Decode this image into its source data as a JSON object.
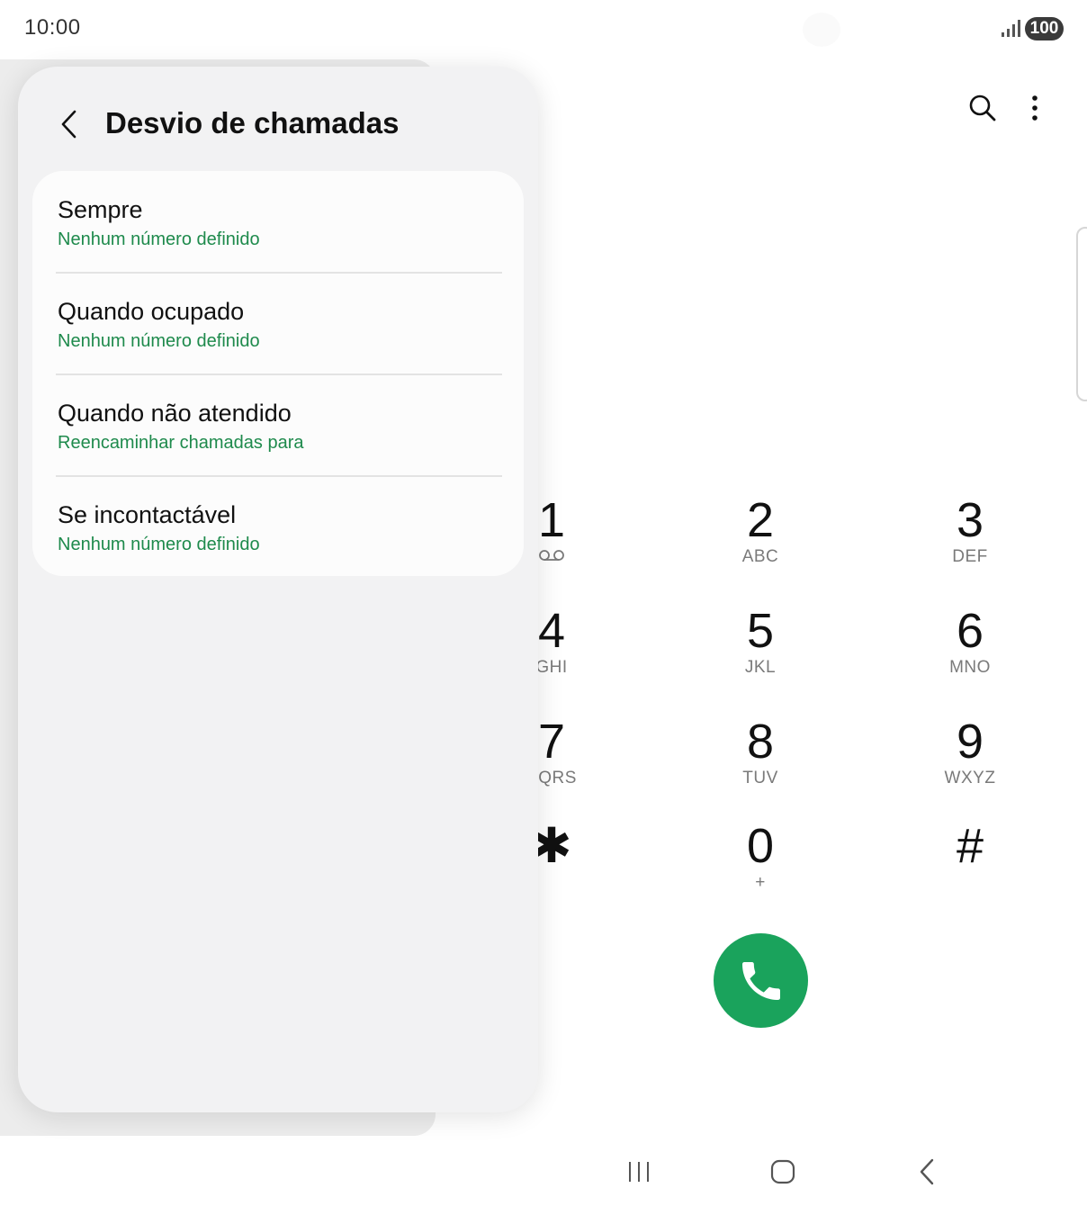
{
  "status_bar": {
    "time": "10:00",
    "battery": "100",
    "icons": [
      "signal-icon",
      "battery-icon"
    ]
  },
  "dialer": {
    "keys": [
      {
        "digit": "1",
        "letters": ""
      },
      {
        "digit": "2",
        "letters": "ABC"
      },
      {
        "digit": "3",
        "letters": "DEF"
      },
      {
        "digit": "4",
        "letters": "GHI"
      },
      {
        "digit": "5",
        "letters": "JKL"
      },
      {
        "digit": "6",
        "letters": "MNO"
      },
      {
        "digit": "7",
        "letters": "PQRS"
      },
      {
        "digit": "8",
        "letters": "TUV"
      },
      {
        "digit": "9",
        "letters": "WXYZ"
      },
      {
        "digit": "✱",
        "letters": ""
      },
      {
        "digit": "0",
        "letters": "+"
      },
      {
        "digit": "#",
        "letters": ""
      }
    ],
    "call_color": "#1aa35c",
    "icons": [
      "search-icon",
      "more-options-icon",
      "voicemail-icon",
      "phone-icon"
    ]
  },
  "panel": {
    "title": "Desvio de chamadas",
    "accent": "#1e8a4c",
    "options": [
      {
        "label": "Sempre",
        "sub": "Nenhum número definido"
      },
      {
        "label": "Quando ocupado",
        "sub": "Nenhum número definido"
      },
      {
        "label": "Quando não atendido",
        "sub": "Reencaminhar chamadas para"
      },
      {
        "label": "Se incontactável",
        "sub": "Nenhum número definido"
      }
    ]
  },
  "nav_bar": {
    "icons": [
      "recents-icon",
      "home-icon",
      "back-icon"
    ]
  }
}
